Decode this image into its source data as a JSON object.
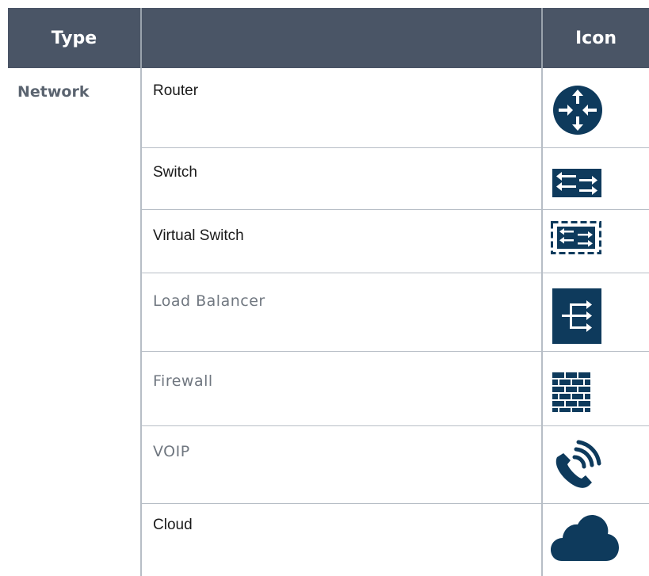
{
  "header": {
    "type_label": "Type",
    "middle_label": "",
    "icon_label": "Icon"
  },
  "category": "Network",
  "rows": [
    {
      "name": "Router",
      "icon": "router-icon"
    },
    {
      "name": "Switch",
      "icon": "switch-icon"
    },
    {
      "name": "Virtual Switch",
      "icon": "virtual-switch-icon"
    },
    {
      "name": "Load Balancer",
      "icon": "load-balancer-icon"
    },
    {
      "name": "Firewall",
      "icon": "firewall-icon"
    },
    {
      "name": "VOIP",
      "icon": "voip-icon"
    },
    {
      "name": "Cloud",
      "icon": "cloud-icon"
    }
  ],
  "colors": {
    "header_bg": "#4a5566",
    "icon_fill": "#0e3a5c",
    "grid": "#b7bec6"
  }
}
